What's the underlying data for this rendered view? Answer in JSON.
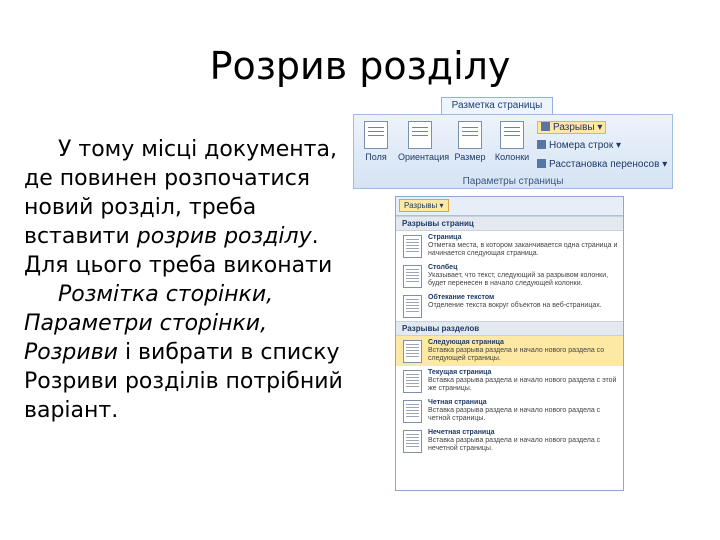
{
  "slide": {
    "title": "Розрив розділу",
    "p1": "У тому місці документа, де повинен розпочатися новий розділ, треба вставити ",
    "p1_italic": "розрив розділу",
    "p1_end": ". Для цього треба виконати",
    "p2_italic": "Розмітка сторінки, Параметри сторінки, Розриви",
    "p2_mid": " і вибрати в списку ",
    "p2_end": "Розриви розділів потрібний варіант."
  },
  "ribbon": {
    "tab": "Разметка страницы",
    "buttons": [
      "Поля",
      "Ориентация",
      "Размер",
      "Колонки"
    ],
    "small": [
      "Разрывы ▾",
      "Номера строк ▾",
      "Расстановка переносов ▾"
    ],
    "group": "Параметры страницы"
  },
  "menu": {
    "button": "Разрывы ▾",
    "sections": [
      {
        "header": "Разрывы страниц",
        "items": [
          {
            "title": "Страница",
            "desc": "Отметка места, в котором заканчивается одна страница и начинается следующая страница."
          },
          {
            "title": "Столбец",
            "desc": "Указывает, что текст, следующий за разрывом колонки, будет перенесен в начало следующей колонки."
          },
          {
            "title": "Обтекание текстом",
            "desc": "Отделение текста вокруг объектов на веб-страницах."
          }
        ]
      },
      {
        "header": "Разрывы разделов",
        "items": [
          {
            "title": "Следующая страница",
            "desc": "Вставка разрыва раздела и начало нового раздела со следующей страницы.",
            "highlighted": true
          },
          {
            "title": "Текущая страница",
            "desc": "Вставка разрыва раздела и начало нового раздела с этой же страницы."
          },
          {
            "title": "Четная страница",
            "desc": "Вставка разрыва раздела и начало нового раздела с четной страницы."
          },
          {
            "title": "Нечетная страница",
            "desc": "Вставка разрыва раздела и начало нового раздела с нечетной страницы."
          }
        ]
      }
    ]
  }
}
